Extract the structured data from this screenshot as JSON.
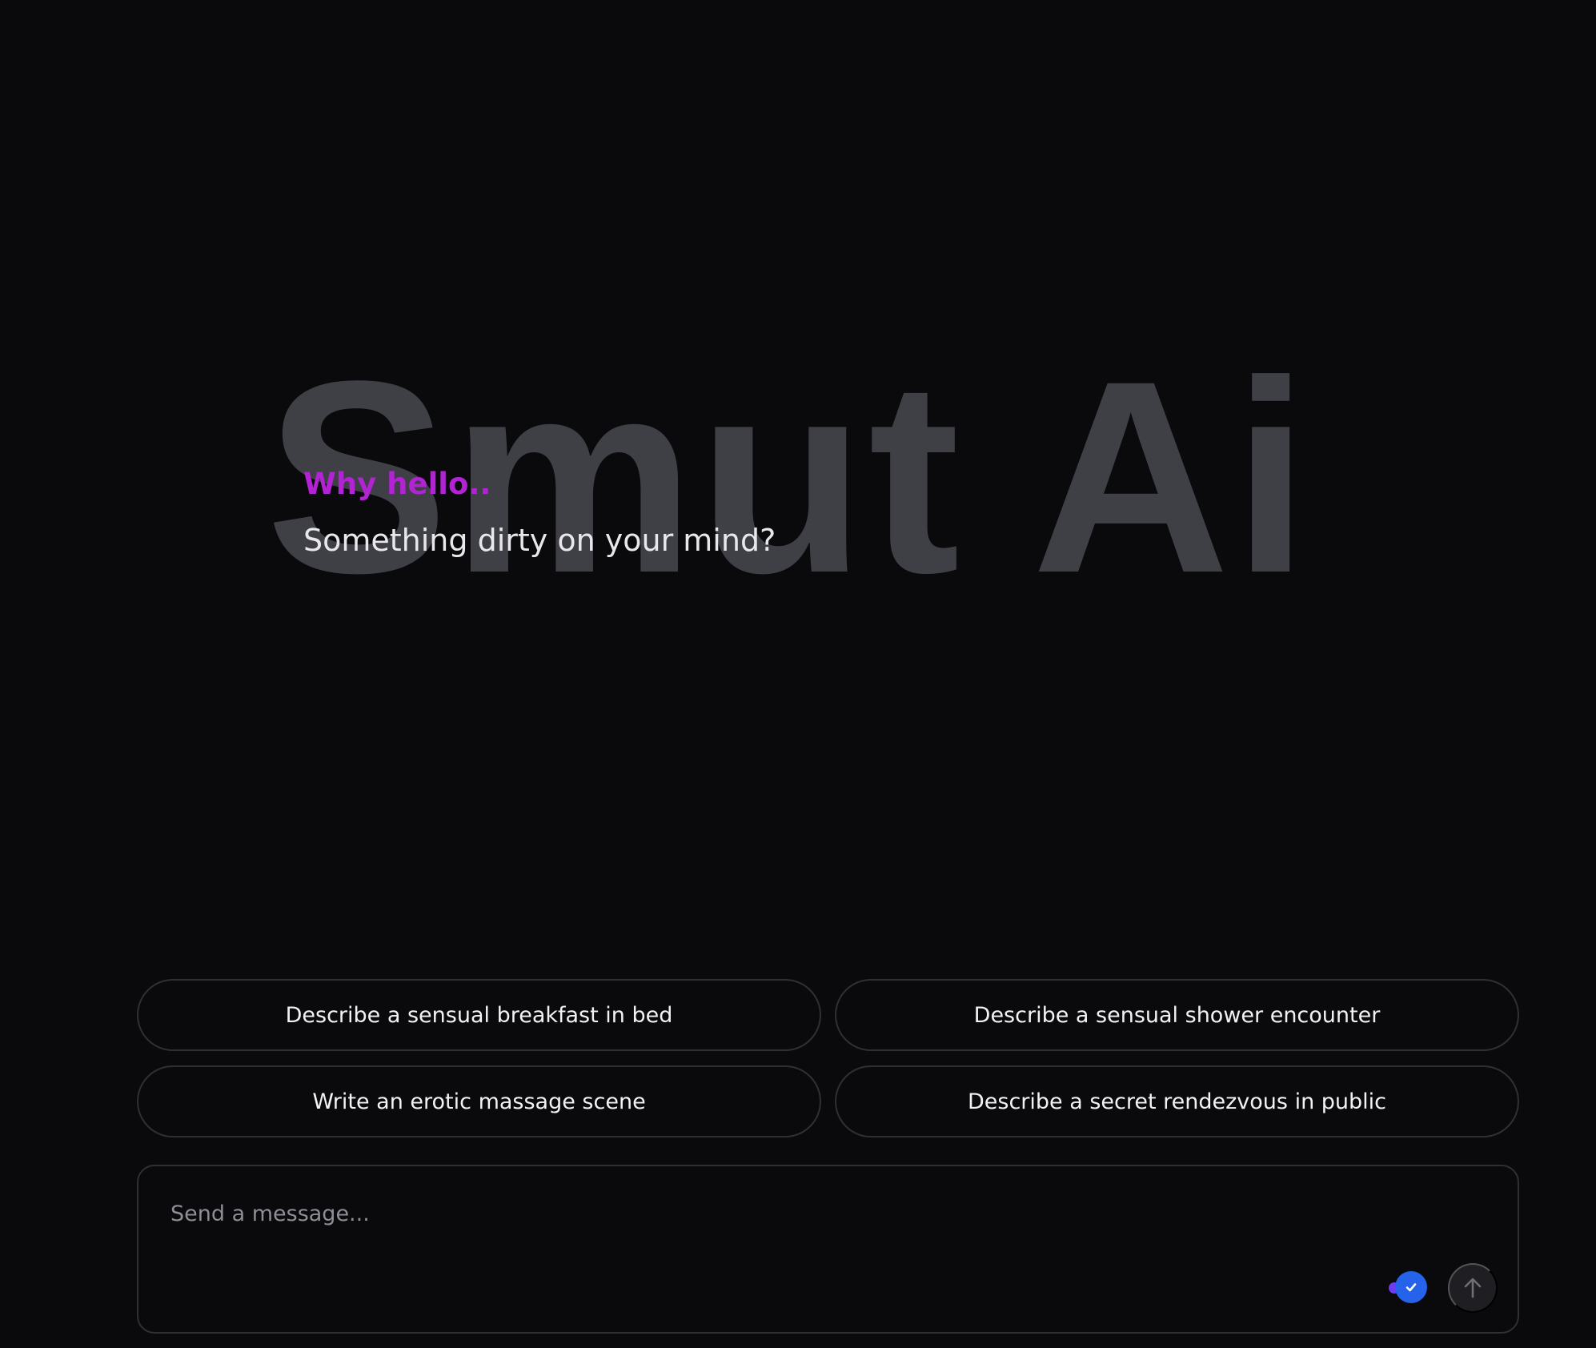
{
  "brand": {
    "title": "Smut Ai"
  },
  "intro": {
    "greeting": "Why hello..",
    "subtitle": "Something dirty on your mind?"
  },
  "suggestions": [
    "Describe a sensual breakfast in bed",
    "Describe a sensual shower encounter",
    "Write an erotic massage scene",
    "Describe a secret rendezvous in public"
  ],
  "composer": {
    "placeholder": "Send a message...",
    "value": "",
    "toggle_icon": "check-icon",
    "send_icon": "arrow-up-icon"
  },
  "colors": {
    "background": "#0a0a0d",
    "brand_text": "#3f3f46",
    "greeting": "#b223d3",
    "border": "#2f2f35",
    "toggle_accent": "#2563eb",
    "toggle_dot": "#6d3cf0",
    "send_button": "#1f1f23"
  }
}
